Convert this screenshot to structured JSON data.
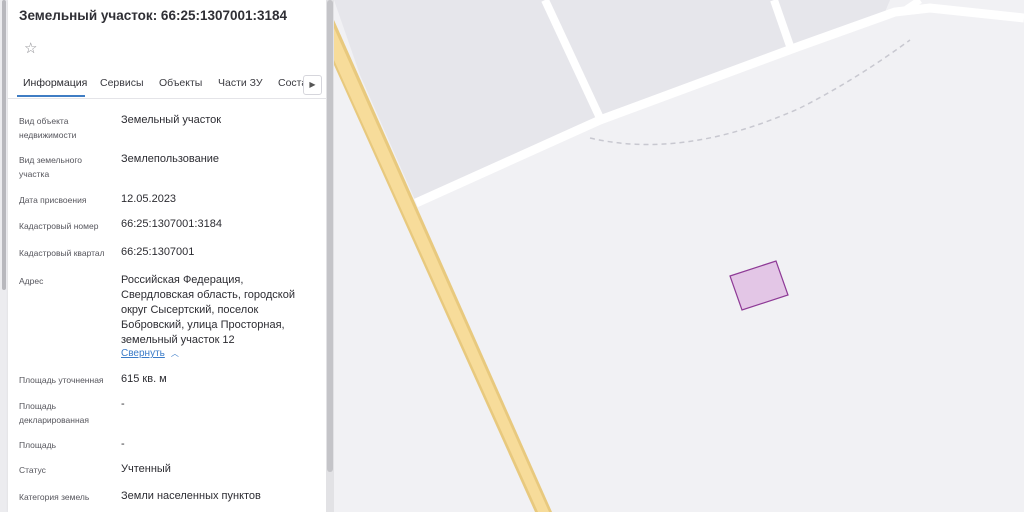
{
  "header": {
    "title": "Земельный участок: 66:25:1307001:3184",
    "favorite_icon": "star-icon"
  },
  "tabs": [
    {
      "label": "Информация",
      "active": true
    },
    {
      "label": "Сервисы"
    },
    {
      "label": "Объекты"
    },
    {
      "label": "Части ЗУ"
    },
    {
      "label": "Состав"
    }
  ],
  "tabs_next_icon": "chevron-right-icon",
  "details": {
    "object_type": {
      "label": "Вид объекта недвижимости",
      "value": "Земельный участок"
    },
    "land_type": {
      "label": "Вид земельного участка",
      "value": "Землепользование"
    },
    "assign_date": {
      "label": "Дата присвоения",
      "value": "12.05.2023"
    },
    "cadastral_number": {
      "label": "Кадастровый номер",
      "value": "66:25:1307001:3184"
    },
    "cadastral_quarter": {
      "label": "Кадастровый квартал",
      "value": "66:25:1307001"
    },
    "address": {
      "label": "Адрес",
      "value": "Российская Федерация, Свердловская область, городской округ Сысертский, поселок Бобровский, улица Просторная, земельный участок 12",
      "collapse_label": "Свернуть"
    },
    "area_refined": {
      "label": "Площадь уточненная",
      "value": "615 кв. м"
    },
    "area_declared": {
      "label": "Площадь декларированная",
      "value": "-"
    },
    "area": {
      "label": "Площадь",
      "value": "-"
    },
    "status": {
      "label": "Статус",
      "value": "Учтенный"
    },
    "land_category": {
      "label": "Категория земель",
      "value": "Земли населенных пунктов"
    }
  },
  "map": {
    "road_color": "#f7dc9a",
    "parcel_fill": "#e3c6e6",
    "parcel_stroke": "#8e3a96"
  }
}
